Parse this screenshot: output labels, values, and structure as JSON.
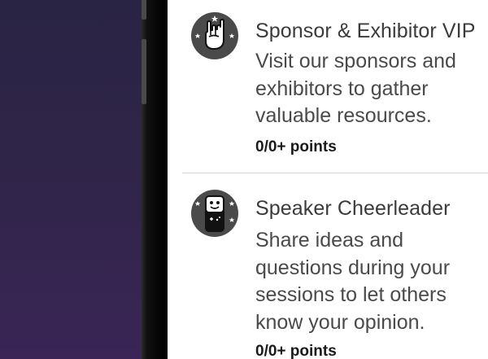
{
  "achievements": [
    {
      "icon": "rock-on-hand-icon",
      "title": "Sponsor & Exhibitor VIP",
      "description_lines": [
        "Visit our sponsors and",
        "exhibitors to gather",
        "valuable resources."
      ],
      "points": "0/0+ points"
    },
    {
      "icon": "smiley-phone-icon",
      "title": "Speaker Cheerleader",
      "description_lines": [
        "Share ideas and",
        "questions during  your",
        "sessions to let others",
        "know your opinion."
      ],
      "points": "0/0+ points"
    }
  ],
  "colors": {
    "badge": "#4a4a4a",
    "title": "#3b3b3b",
    "description": "#4a4a4a",
    "points": "#1a1a1a",
    "divider": "#d6d6d6",
    "wallpaper": "#2f2548"
  }
}
